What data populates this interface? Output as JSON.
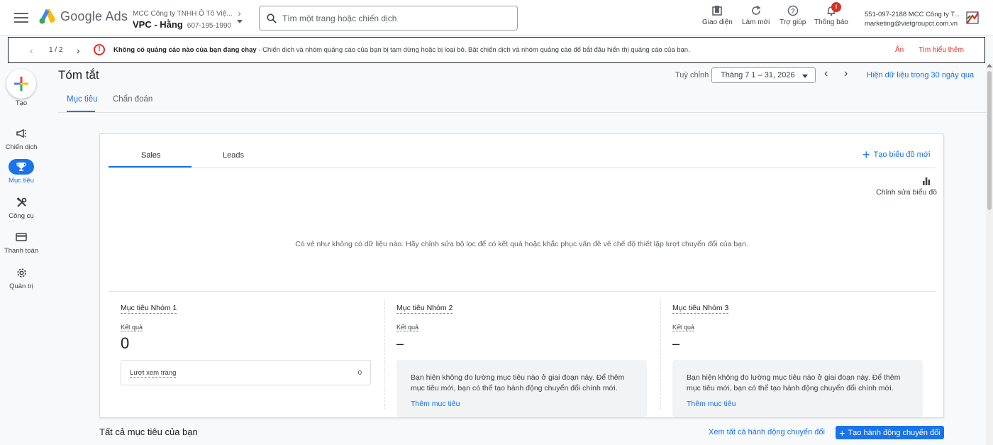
{
  "header": {
    "logo_text": "Google Ads",
    "mcc_name": "MCC Công ty TNHH Ô Tô Việ...",
    "account_name": "VPC - Hằng",
    "account_id": "607-195-1990",
    "search_placeholder": "Tìm một trang hoặc chiến dịch",
    "tools": {
      "appearance": "Giao diện",
      "refresh": "Làm mới",
      "help": "Trợ giúp",
      "notifications": "Thông báo",
      "notifications_badge": "!"
    },
    "user": {
      "line1": "551-097-2188 MCC Công ty T...",
      "email": "marketing@vietgroupct.com.vn"
    }
  },
  "banner": {
    "page": "1 / 2",
    "icon": "!",
    "bold": "Không có quảng cáo nào của bạn đang chạy",
    "text": " - Chiến dịch và nhóm quảng cáo của bạn bị tạm dừng hoặc bị loại bỏ. Bật chiến dịch và nhóm quảng cáo để bắt đầu hiển thị quảng cáo của bạn.",
    "hide": "Ẩn",
    "learn_more": "Tìm hiểu thêm"
  },
  "sidenav": {
    "create": "Tạo",
    "campaigns": "Chiến dịch",
    "goals": "Mục tiêu",
    "tools": "Công cụ",
    "billing": "Thanh toán",
    "admin": "Quản trị"
  },
  "page": {
    "title": "Tóm tắt",
    "date_label": "Tuỳ chỉnh",
    "date_range": "Tháng 7 1 – 31, 2026",
    "last30": "Hiện dữ liệu trong 30 ngày qua",
    "tabs": [
      "Mục tiêu",
      "Chẩn đoán"
    ]
  },
  "card": {
    "tabs": [
      "Sales",
      "Leads"
    ],
    "new_chart": "Tạo biểu đồ mới",
    "edit_chart": "Chỉnh sửa biểu đồ",
    "empty_message": "Có vẻ như không có dữ liệu nào. Hãy chỉnh sửa bộ lọc để có kết quả hoặc khắc phục vấn đề về chế độ thiết lập lượt chuyển đổi của bạn.",
    "goals": [
      {
        "title": "Mục tiêu Nhóm 1",
        "label": "Kết quả",
        "value": "0",
        "metric_label": "Lượt xem trang",
        "metric_value": "0"
      },
      {
        "title": "Mục tiêu Nhóm 2",
        "label": "Kết quả",
        "value": "–",
        "info": "Bạn hiện không đo lường mục tiêu nào ở giai đoạn này. Để thêm mục tiêu mới, bạn có thể tạo hành động chuyển đổi chính mới.",
        "add": "Thêm mục tiêu"
      },
      {
        "title": "Mục tiêu Nhóm 3",
        "label": "Kết quả",
        "value": "–",
        "info": "Bạn hiện không đo lường mục tiêu nào ở giai đoạn này. Để thêm mục tiêu mới, bạn có thể tạo hành động chuyển đổi chính mới.",
        "add": "Thêm mục tiêu"
      }
    ]
  },
  "footer": {
    "all_goals": "Tất cả mục tiêu của bạn",
    "view_all": "Xem tất cả hành động chuyển đổi",
    "create_conversion": "Tạo hành động chuyển đổi"
  },
  "colors": {
    "accent": "#1a73e8",
    "error": "#d93025"
  }
}
